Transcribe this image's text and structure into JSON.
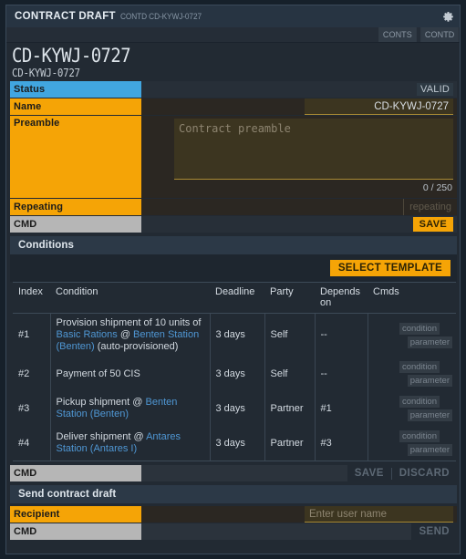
{
  "titlebar": {
    "title": "CONTRACT DRAFT",
    "subtitle": "CONTD CD-KYWJ-0727",
    "gear_icon": "gear-icon"
  },
  "breadcrumbs": [
    {
      "label": "CONTS"
    },
    {
      "label": "CONTD"
    }
  ],
  "header": {
    "id_large": "CD-KYWJ-0727",
    "id_small": "CD-KYWJ-0727"
  },
  "form": {
    "status": {
      "label": "Status",
      "value": "VALID"
    },
    "name": {
      "label": "Name",
      "value": "CD-KYWJ-0727"
    },
    "preamble": {
      "label": "Preamble",
      "placeholder": "Contract preamble",
      "value": "",
      "counter": "0 / 250"
    },
    "repeating": {
      "label": "Repeating",
      "checkbox_label": "repeating"
    },
    "cmd": {
      "label": "CMD",
      "save_label": "SAVE"
    }
  },
  "conditions": {
    "section_title": "Conditions",
    "select_template_label": "SELECT TEMPLATE",
    "columns": [
      "Index",
      "Condition",
      "Deadline",
      "Party",
      "Depends on",
      "Cmds"
    ],
    "rows": [
      {
        "index": "#1",
        "condition_parts": [
          {
            "text": "Provision shipment of 10 units of ",
            "link": false
          },
          {
            "text": "Basic Rations",
            "link": true
          },
          {
            "text": " @ ",
            "link": false
          },
          {
            "text": "Benten Station (Benten)",
            "link": true
          },
          {
            "text": " (auto-provisioned)",
            "link": false
          }
        ],
        "deadline": "3 days",
        "party": "Self",
        "depends_on": "--",
        "cmds": [
          "condition",
          "parameter"
        ]
      },
      {
        "index": "#2",
        "condition_parts": [
          {
            "text": "Payment of 50 CIS",
            "link": false
          }
        ],
        "deadline": "3 days",
        "party": "Self",
        "depends_on": "--",
        "cmds": [
          "condition",
          "parameter"
        ]
      },
      {
        "index": "#3",
        "condition_parts": [
          {
            "text": "Pickup shipment @ ",
            "link": false
          },
          {
            "text": "Benten Station (Benten)",
            "link": true
          }
        ],
        "deadline": "3 days",
        "party": "Partner",
        "depends_on": "#1",
        "cmds": [
          "condition",
          "parameter"
        ]
      },
      {
        "index": "#4",
        "condition_parts": [
          {
            "text": "Deliver shipment @ ",
            "link": false
          },
          {
            "text": "Antares Station (Antares I)",
            "link": true
          }
        ],
        "deadline": "3 days",
        "party": "Partner",
        "depends_on": "#3",
        "cmds": [
          "condition",
          "parameter"
        ]
      }
    ]
  },
  "conditions_cmd": {
    "label": "CMD",
    "save_label": "SAVE",
    "discard_label": "DISCARD"
  },
  "send": {
    "section_title": "Send contract draft",
    "recipient": {
      "label": "Recipient",
      "placeholder": "Enter user name",
      "value": ""
    },
    "cmd": {
      "label": "CMD",
      "send_label": "SEND"
    }
  },
  "colors": {
    "accent_gold": "#f5a406",
    "accent_blue": "#41a6e0",
    "link_blue": "#4f97d4",
    "label_gray": "#b6b6b6",
    "window_bg": "#222a33",
    "section_header": "#2c3947",
    "field_bg": "#3c3520",
    "field_underline": "#a98a33"
  }
}
